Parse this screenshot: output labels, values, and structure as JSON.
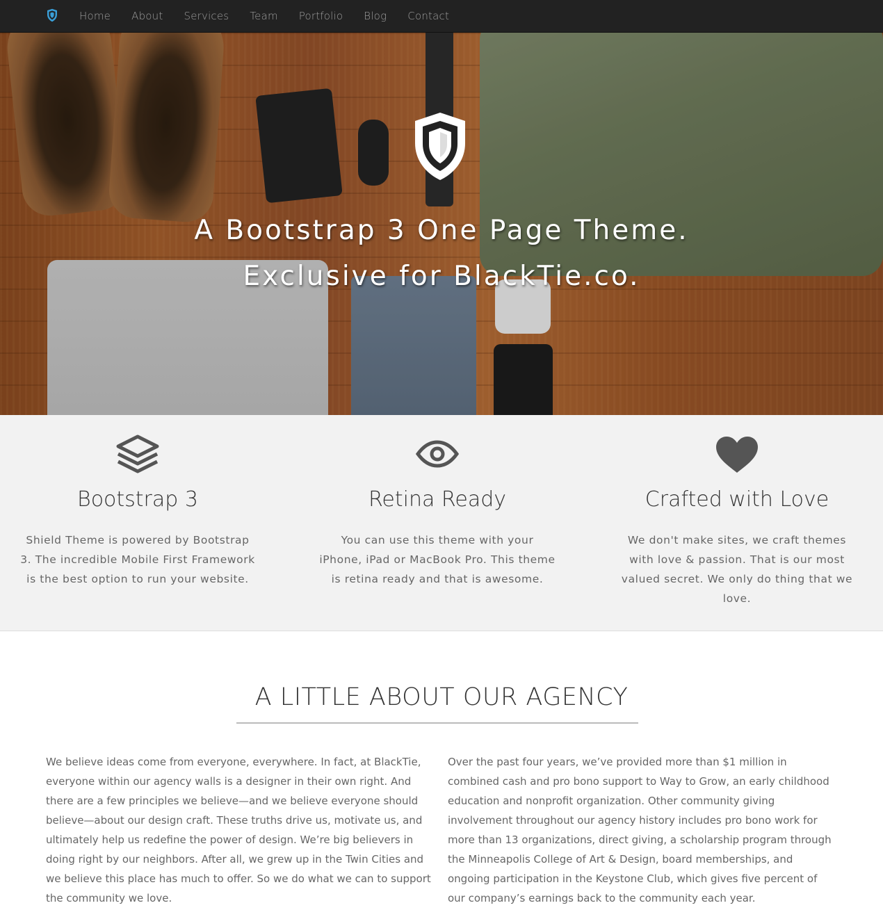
{
  "nav": {
    "brand_icon": "shield-icon",
    "items": [
      {
        "label": "Home"
      },
      {
        "label": "About"
      },
      {
        "label": "Services"
      },
      {
        "label": "Team"
      },
      {
        "label": "Portfolio"
      },
      {
        "label": "Blog"
      },
      {
        "label": "Contact"
      }
    ]
  },
  "hero": {
    "logo_icon": "shield-icon",
    "line1": "A Bootstrap 3 One Page Theme.",
    "line2": "Exclusive for BlackTie.co."
  },
  "features": [
    {
      "icon": "layers-icon",
      "title": "Bootstrap 3",
      "text": "Shield Theme is powered by Bootstrap 3. The incredible Mobile First Framework is the best option to run your website."
    },
    {
      "icon": "eye-icon",
      "title": "Retina Ready",
      "text": "You can use this theme with your iPhone, iPad or MacBook Pro. This theme is retina ready and that is awesome."
    },
    {
      "icon": "heart-icon",
      "title": "Crafted with Love",
      "text": "We don't make sites, we craft themes with love & passion. That is our most valued secret. We only do thing that we love."
    }
  ],
  "about": {
    "heading": "A LITTLE ABOUT OUR AGENCY",
    "left": "We believe ideas come from everyone, everywhere. In fact, at BlackTie, everyone within our agency walls is a designer in their own right. And there are a few principles we believe—and we believe everyone should believe—about our design craft. These truths drive us, motivate us, and ultimately help us redefine the power of design. We’re big believers in doing right by our neighbors. After all, we grew up in the Twin Cities and we believe this place has much to offer. So we do what we can to support the community we love.",
    "right": "Over the past four years, we’ve provided more than $1 million in combined cash and pro bono support to Way to Grow, an early childhood education and nonprofit organization. Other community giving involvement throughout our agency history includes pro bono work for more than 13 organizations, direct giving, a scholarship program through the Minneapolis College of Art & Design, board memberships, and ongoing participation in the Keystone Club, which gives five percent of our company’s earnings back to the community each year."
  },
  "colors": {
    "navbar_bg": "#222222",
    "nav_text": "#9d9d9d",
    "brand_accent": "#3a9fd8",
    "features_bg": "#f2f2f2",
    "icon_gray": "#555555"
  }
}
